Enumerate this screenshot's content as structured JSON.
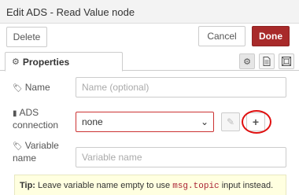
{
  "dialog": {
    "title": "Edit ADS - Read Value node",
    "delete_label": "Delete",
    "cancel_label": "Cancel",
    "done_label": "Done"
  },
  "tabs": {
    "properties_label": "Properties",
    "icons": [
      "gear-icon",
      "description-icon",
      "appearance-icon"
    ]
  },
  "form": {
    "name_label": "Name",
    "name_value": "",
    "name_placeholder": "Name (optional)",
    "connection_label_line1": "ADS",
    "connection_label_line2": "connection",
    "connection_selected": "none",
    "variable_label_line1": "Variable",
    "variable_label_line2": "name",
    "variable_value": "",
    "variable_placeholder": "Variable name"
  },
  "tip": {
    "prefix": "Tip:",
    "text_before": " Leave variable name empty to use ",
    "code": "msg.topic",
    "text_after": " input instead."
  },
  "colors": {
    "done_button": "#a82a2a",
    "annotation_circle": "#e01010",
    "tip_background": "#ffffe0"
  }
}
